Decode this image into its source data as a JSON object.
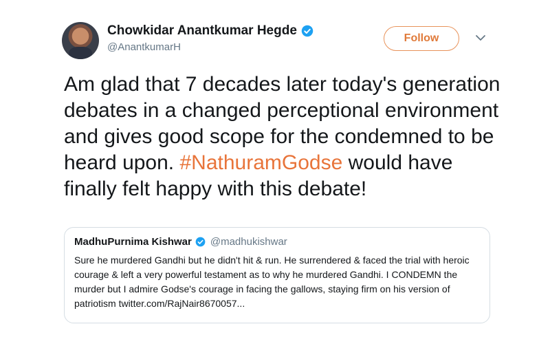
{
  "author": {
    "display_name": "Chowkidar Anantkumar Hegde",
    "handle": "@AnantkumarH",
    "verified": true
  },
  "actions": {
    "follow_label": "Follow"
  },
  "tweet": {
    "text_before_hashtag": "Am glad that 7 decades later today's generation debates in a changed perceptional environment and gives good scope for the  condemned to be heard upon.",
    "hashtag": "#NathuramGodse",
    "text_after_hashtag": " would have finally felt happy with this debate!"
  },
  "quoted_tweet": {
    "display_name": "MadhuPurnima Kishwar",
    "handle": "@madhukishwar",
    "verified": true,
    "text": "Sure he murdered Gandhi but he didn't hit & run. He surrendered & faced the trial with heroic courage & left a very powerful testament as to why he murdered Gandhi. I CONDEMN the murder but I admire Godse's courage in facing the gallows, staying firm on his version of patriotism twitter.com/RajNair8670057..."
  },
  "colors": {
    "accent": "#e8743a",
    "verified_badge": "#1da1f2",
    "secondary_text": "#657786"
  },
  "icons": {
    "verified": "verified-badge-icon",
    "caret": "chevron-down-icon",
    "avatar": "avatar-photo"
  }
}
